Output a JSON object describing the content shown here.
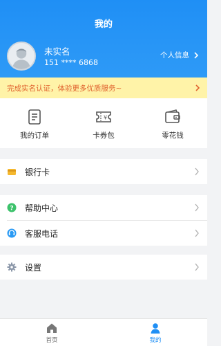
{
  "header": {
    "title": "我的"
  },
  "user": {
    "name": "未实名",
    "phone": "151 **** 6868",
    "personal_info_label": "个人信息"
  },
  "notice": {
    "text": "完成实名认证，体验更多优质服务~"
  },
  "quick_actions": [
    {
      "label": "我的订单",
      "icon": "order-icon"
    },
    {
      "label": "卡券包",
      "icon": "coupon-icon"
    },
    {
      "label": "零花钱",
      "icon": "wallet-icon"
    }
  ],
  "menu": {
    "bank_card": "银行卡",
    "help_center": "帮助中心",
    "customer_service": "客服电话",
    "settings": "设置"
  },
  "tabbar": {
    "home": "首页",
    "mine": "我的"
  },
  "colors": {
    "primary": "#1f8ff5",
    "notice_bg": "#fff3a8",
    "notice_text": "#e0622e",
    "icon_gray": "#555555"
  }
}
